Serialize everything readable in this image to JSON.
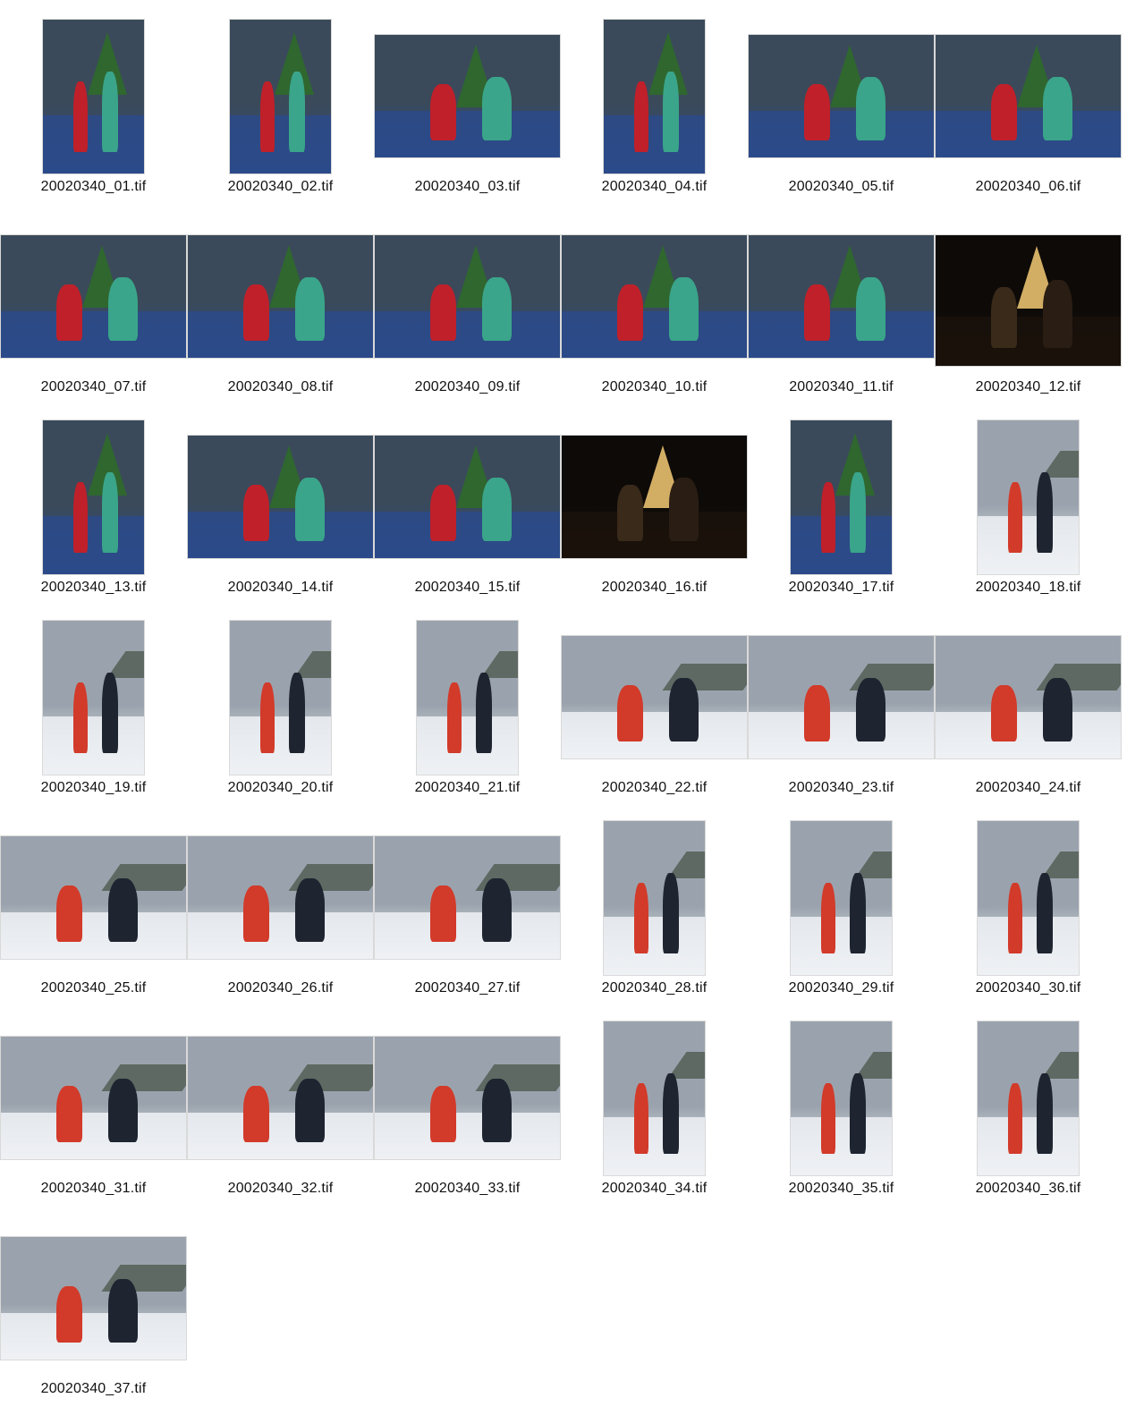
{
  "contact_sheet": {
    "photos": [
      {
        "caption": "20020340_01.tif",
        "orientation": "portrait",
        "scene": "indoor"
      },
      {
        "caption": "20020340_02.tif",
        "orientation": "portrait",
        "scene": "indoor"
      },
      {
        "caption": "20020340_03.tif",
        "orientation": "landscape",
        "scene": "indoor"
      },
      {
        "caption": "20020340_04.tif",
        "orientation": "portrait",
        "scene": "indoor"
      },
      {
        "caption": "20020340_05.tif",
        "orientation": "landscape",
        "scene": "indoor"
      },
      {
        "caption": "20020340_06.tif",
        "orientation": "landscape",
        "scene": "indoor"
      },
      {
        "caption": "20020340_07.tif",
        "orientation": "landscape",
        "scene": "indoor"
      },
      {
        "caption": "20020340_08.tif",
        "orientation": "landscape",
        "scene": "indoor"
      },
      {
        "caption": "20020340_09.tif",
        "orientation": "landscape",
        "scene": "indoor"
      },
      {
        "caption": "20020340_10.tif",
        "orientation": "landscape",
        "scene": "indoor"
      },
      {
        "caption": "20020340_11.tif",
        "orientation": "landscape",
        "scene": "indoor"
      },
      {
        "caption": "20020340_12.tif",
        "orientation": "night",
        "scene": "dark"
      },
      {
        "caption": "20020340_13.tif",
        "orientation": "portrait",
        "scene": "indoor"
      },
      {
        "caption": "20020340_14.tif",
        "orientation": "landscape",
        "scene": "indoor"
      },
      {
        "caption": "20020340_15.tif",
        "orientation": "landscape",
        "scene": "indoor"
      },
      {
        "caption": "20020340_16.tif",
        "orientation": "landscape",
        "scene": "dark"
      },
      {
        "caption": "20020340_17.tif",
        "orientation": "portrait",
        "scene": "indoor"
      },
      {
        "caption": "20020340_18.tif",
        "orientation": "portrait",
        "scene": "snow"
      },
      {
        "caption": "20020340_19.tif",
        "orientation": "portrait",
        "scene": "snow"
      },
      {
        "caption": "20020340_20.tif",
        "orientation": "portrait",
        "scene": "snow"
      },
      {
        "caption": "20020340_21.tif",
        "orientation": "portrait",
        "scene": "snow"
      },
      {
        "caption": "20020340_22.tif",
        "orientation": "landscape",
        "scene": "snow"
      },
      {
        "caption": "20020340_23.tif",
        "orientation": "landscape",
        "scene": "snow"
      },
      {
        "caption": "20020340_24.tif",
        "orientation": "landscape",
        "scene": "snow"
      },
      {
        "caption": "20020340_25.tif",
        "orientation": "landscape",
        "scene": "snow"
      },
      {
        "caption": "20020340_26.tif",
        "orientation": "landscape",
        "scene": "snow"
      },
      {
        "caption": "20020340_27.tif",
        "orientation": "landscape",
        "scene": "snow"
      },
      {
        "caption": "20020340_28.tif",
        "orientation": "portrait",
        "scene": "snow"
      },
      {
        "caption": "20020340_29.tif",
        "orientation": "portrait",
        "scene": "snow"
      },
      {
        "caption": "20020340_30.tif",
        "orientation": "portrait",
        "scene": "snow"
      },
      {
        "caption": "20020340_31.tif",
        "orientation": "landscape",
        "scene": "snow"
      },
      {
        "caption": "20020340_32.tif",
        "orientation": "landscape",
        "scene": "snow"
      },
      {
        "caption": "20020340_33.tif",
        "orientation": "landscape",
        "scene": "snow"
      },
      {
        "caption": "20020340_34.tif",
        "orientation": "portrait",
        "scene": "snow"
      },
      {
        "caption": "20020340_35.tif",
        "orientation": "portrait",
        "scene": "snow"
      },
      {
        "caption": "20020340_36.tif",
        "orientation": "portrait",
        "scene": "snow"
      },
      {
        "caption": "20020340_37.tif",
        "orientation": "landscape",
        "scene": "snow"
      }
    ]
  },
  "palettes": {
    "indoor": {
      "sky": "#3a4a5a",
      "floor": "#2b4a8a",
      "fig1": "#c0202a",
      "fig2": "#3aa58a",
      "deco": "#2f6a2a"
    },
    "dark": {
      "sky": "#0d0a08",
      "floor": "#1a120a",
      "fig1": "#3a2a1a",
      "fig2": "#2a1e14",
      "deco": "#e8c070"
    },
    "snow": {
      "sky": "#9aa3ad",
      "floor": "#eef1f4",
      "fig1": "#d23a2a",
      "fig2": "#1e2430",
      "deco": "#3a4838"
    }
  }
}
